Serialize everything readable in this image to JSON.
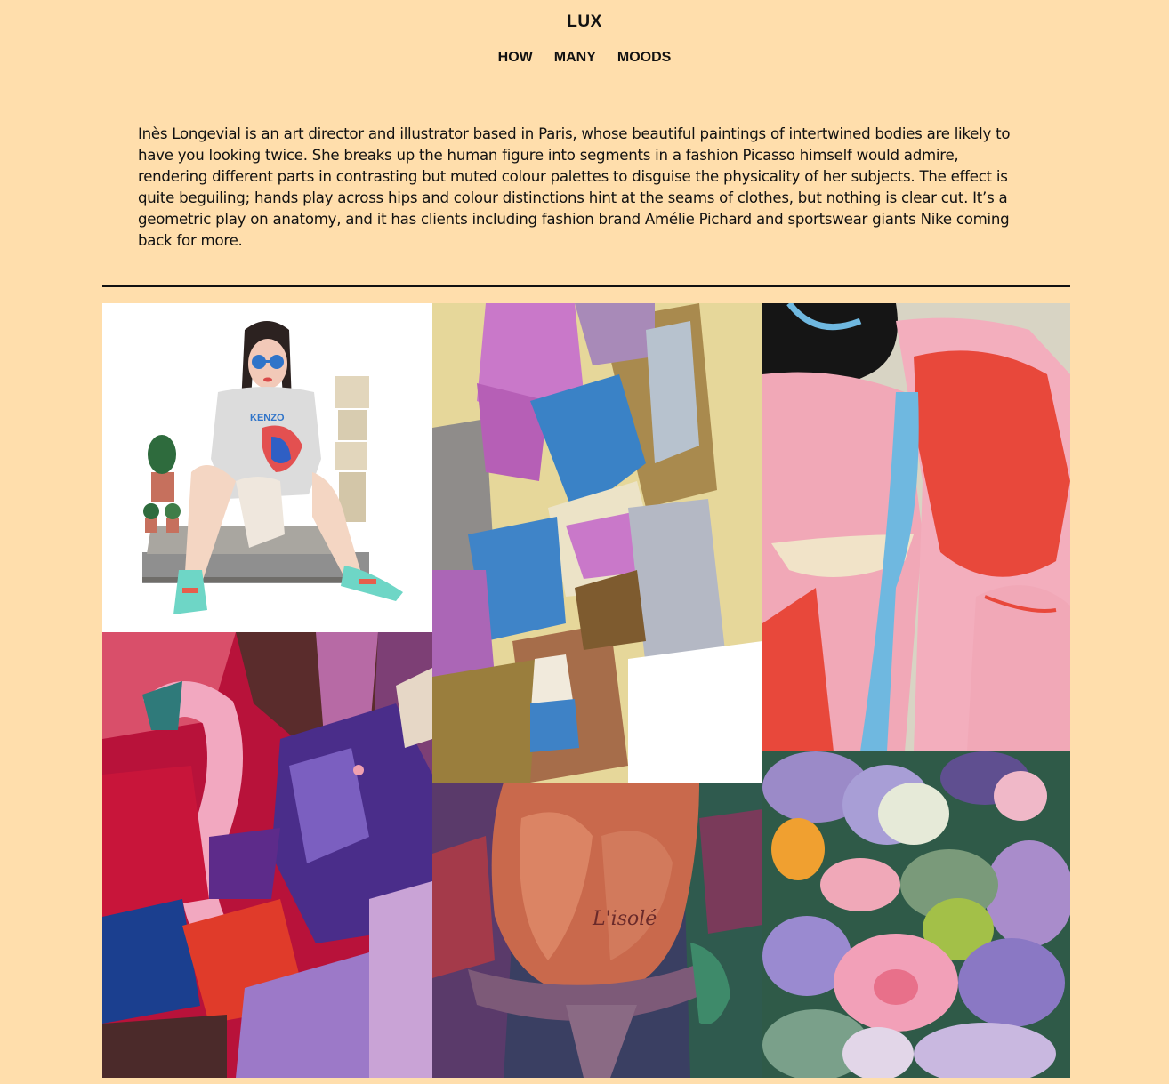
{
  "header": {
    "title": "LUX",
    "nav": [
      "HOW",
      "MANY",
      "MOODS"
    ]
  },
  "intro": {
    "text": "Inès Longevial is an art director and illustrator based in Paris, whose beautiful paintings of intertwined bodies are likely to have you looking twice. She breaks up the human figure into segments in a fashion Picasso himself would admire, rendering different parts in contrasting but muted colour palettes to disguise the physicality of her subjects. The effect is quite beguiling; hands play across hips and colour distinctions hint at the seams of clothes, but nothing is clear cut. It’s a geometric play on anatomy, and it has clients including fashion brand Amélie Pichard and sportswear giants Nike coming back for more."
  },
  "gallery": {
    "sweatshirt_brand": "KENZO",
    "tattoo_script": "L'isolé"
  },
  "colors": {
    "background": "#ffdeac",
    "text": "#111111"
  }
}
